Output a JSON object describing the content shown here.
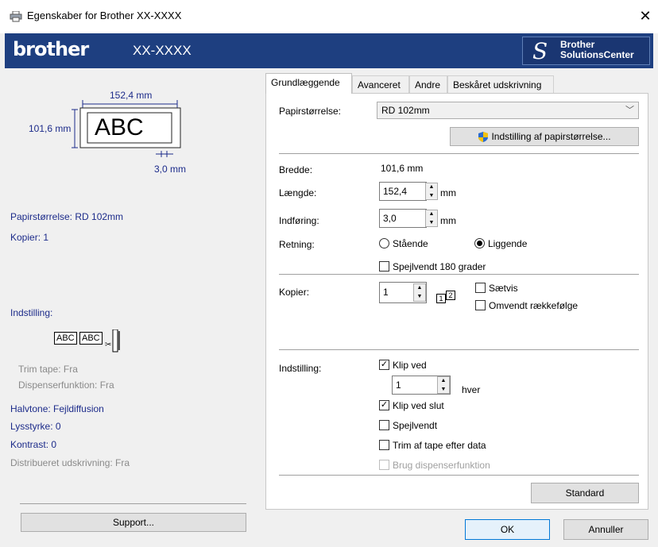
{
  "window": {
    "title": "Egenskaber for Brother XX-XXXX",
    "close_glyph": "✕"
  },
  "brand": {
    "logo": "brother",
    "model": "XX-XXXX",
    "solutions_line1": "Brother",
    "solutions_line2": "SolutionsCenter",
    "color": "#1e3f80"
  },
  "preview": {
    "width_label": "152,4 mm",
    "height_label": "101,6 mm",
    "sample_text": "ABC",
    "margin_label": "3,0 mm",
    "small_sample_1": "ABC",
    "small_sample_2": "ABC"
  },
  "summary": {
    "paper_size": "Papirstørrelse: RD 102mm",
    "copies": "Kopier: 1",
    "setting_header": "Indstilling:",
    "trim_tape": "Trim tape: Fra",
    "dispenser": "Dispenserfunktion: Fra",
    "halftone": "Halvtone: Fejldiffusion",
    "brightness": "Lysstyrke:  0",
    "contrast": "Kontrast:  0",
    "distributed": "Distribueret udskrivning: Fra",
    "support_button": "Support..."
  },
  "tabs": [
    "Grundlæggende",
    "Avanceret",
    "Andre",
    "Beskåret udskrivning"
  ],
  "basic": {
    "paper_size_label": "Papirstørrelse:",
    "paper_size_value": "RD 102mm",
    "paper_setting_button": "Indstilling af papirstørrelse...",
    "width_label": "Bredde:",
    "width_value": "101,6 mm",
    "length_label": "Længde:",
    "length_value": "152,4",
    "feed_label": "Indføring:",
    "feed_value": "3,0",
    "unit_mm": "mm",
    "orientation_label": "Retning:",
    "portrait": "Stående",
    "landscape": "Liggende",
    "mirror_180": "Spejlvendt 180 grader",
    "copies_label": "Kopier:",
    "copies_value": "1",
    "collate": "Sætvis",
    "reverse_order": "Omvendt rækkefølge",
    "collate_icon_1": "1",
    "collate_icon_2": "2",
    "setting_label": "Indstilling:",
    "cut_at": "Klip ved",
    "cut_every_value": "1",
    "every_label": "hver",
    "cut_at_end": "Klip ved slut",
    "mirror": "Spejlvendt",
    "trim_tape_after": "Trim af tape efter data",
    "use_dispenser": "Brug dispenserfunktion",
    "standard_button": "Standard"
  },
  "footer": {
    "ok": "OK",
    "cancel": "Annuller"
  },
  "state": {
    "orientation": "landscape",
    "cut_at_checked": true,
    "cut_at_end_checked": true,
    "mirror_180_checked": false,
    "collate_checked": false,
    "reverse_checked": false,
    "mirror_checked": false,
    "trim_checked": false,
    "dispenser_checked": false,
    "dispenser_enabled": false
  }
}
